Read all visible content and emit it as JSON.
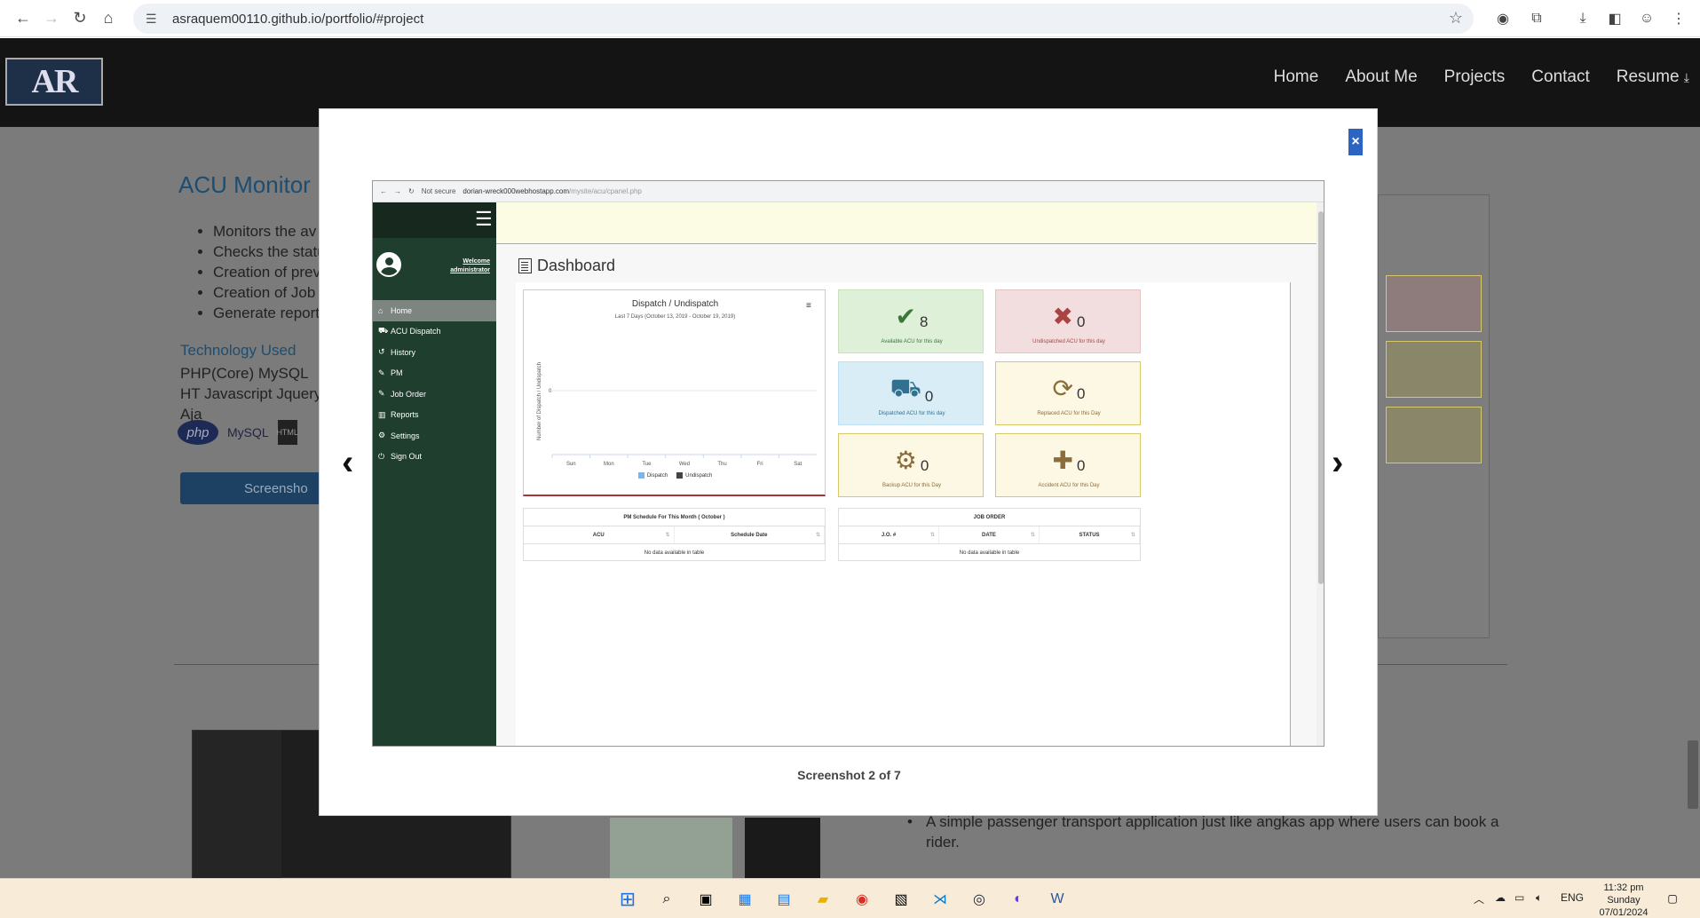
{
  "browser": {
    "url": "asraquem00110.github.io/portfolio/#project"
  },
  "site": {
    "logo_text": "AR",
    "nav": [
      "Home",
      "About Me",
      "Projects",
      "Contact",
      "Resume"
    ]
  },
  "background_page": {
    "project_title": "ACU Monitor",
    "bullets": [
      "Monitors the av",
      "Checks the statu",
      "Creation of prev",
      "Creation of Job",
      "Generate report"
    ],
    "tech_title": "Technology Used",
    "tech_text": "PHP(Core) MySQL HT Javascript Jquery Aja",
    "tech_icons": [
      "php",
      "MySQL",
      "HTML"
    ],
    "screenshot_button": "Screensho",
    "second_project_bullet": "A simple passenger transport application just like angkas app where users can book a rider."
  },
  "modal": {
    "close_label": "×",
    "caption": "Screenshot 2 of 7"
  },
  "inner": {
    "browser": {
      "security": "Not secure",
      "url_host": "dorian-wreck000webhostapp.com",
      "url_path": "/mysite/acu/cpanel.php"
    },
    "sidebar": {
      "welcome_line1": "Welcome",
      "welcome_line2": "administrator",
      "menu": [
        {
          "icon": "⌂",
          "label": "Home"
        },
        {
          "icon": "⛟",
          "label": "ACU Dispatch"
        },
        {
          "icon": "↺",
          "label": "History"
        },
        {
          "icon": "✎",
          "label": "PM"
        },
        {
          "icon": "✎",
          "label": "Job Order"
        },
        {
          "icon": "▥",
          "label": "Reports"
        },
        {
          "icon": "⚙",
          "label": "Settings"
        },
        {
          "icon": "⏻",
          "label": "Sign Out"
        }
      ]
    },
    "dashboard_title": "Dashboard",
    "chart": {
      "title": "Dispatch / Undispatch",
      "subtitle": "Last 7 Days (October 13, 2019 - October 19, 2019)",
      "menu_icon": "≡",
      "ylabel": "Number of Dispatch / Undispatch"
    },
    "cards": [
      {
        "icon": "✔",
        "value": "8",
        "label": "Available ACU for this day",
        "bg": "#dff0d8",
        "icon_color": "#3c763d",
        "border": "#c9e2bd"
      },
      {
        "icon": "✖",
        "value": "0",
        "label": "Undispatched ACU for this day",
        "bg": "#f2dede",
        "icon_color": "#a94442",
        "border": "#e4c3c3"
      },
      {
        "icon": "⛟",
        "value": "0",
        "label": "Dispatched ACU for this day",
        "bg": "#d9edf7",
        "icon_color": "#31708f",
        "border": "#bcdff1"
      },
      {
        "icon": "⟳",
        "value": "0",
        "label": "Replaced ACU for this Day",
        "bg": "#fcf8e3",
        "icon_color": "#8a6d3b",
        "border": "#d4c86a"
      },
      {
        "icon": "⚙",
        "value": "0",
        "label": "Backup ACU for this Day",
        "bg": "#fcf8e3",
        "icon_color": "#8a6d3b",
        "border": "#d4c86a"
      },
      {
        "icon": "✚",
        "value": "0",
        "label": "Accident ACU for this Day",
        "bg": "#fcf8e3",
        "icon_color": "#8a6d3b",
        "border": "#d4c86a"
      }
    ],
    "pm_table": {
      "title": "PM Schedule For This Month ( October )",
      "columns": [
        "ACU",
        "Schedule Date"
      ],
      "empty": "No data available in table"
    },
    "job_table": {
      "title": "JOB ORDER",
      "columns": [
        "J.O. #",
        "DATE",
        "STATUS"
      ],
      "empty": "No data available in table"
    }
  },
  "chart_data": {
    "type": "line",
    "title": "Dispatch / Undispatch",
    "subtitle": "Last 7 Days (October 13, 2019 - October 19, 2019)",
    "categories": [
      "Sun",
      "Mon",
      "Tue",
      "Wed",
      "Thu",
      "Fri",
      "Sat"
    ],
    "series": [
      {
        "name": "Dispatch",
        "values": [],
        "color": "#7cb5ec"
      },
      {
        "name": "Undispatch",
        "values": [],
        "color": "#434348"
      }
    ],
    "xlabel": "",
    "ylabel": "Number of Dispatch / Undispatch",
    "yticks": [
      "0"
    ],
    "legend": "bottom"
  },
  "taskbar": {
    "tray_lang": "ENG",
    "time": "11:32 pm",
    "day": "Sunday",
    "date": "07/01/2024"
  }
}
